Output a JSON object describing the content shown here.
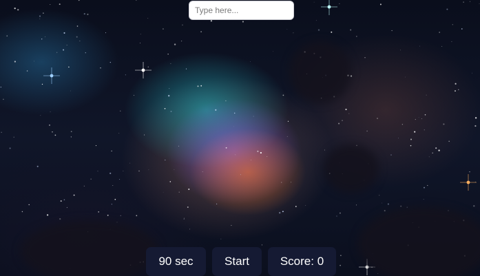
{
  "input": {
    "placeholder": "Type here..."
  },
  "hud": {
    "timer_label": "90 sec",
    "start_label": "Start",
    "score_label": "Score: 0"
  },
  "colors": {
    "button_bg": "#151a33",
    "button_text": "#ffffff",
    "input_bg": "#ffffff"
  },
  "background": {
    "scene": "space-nebula"
  }
}
